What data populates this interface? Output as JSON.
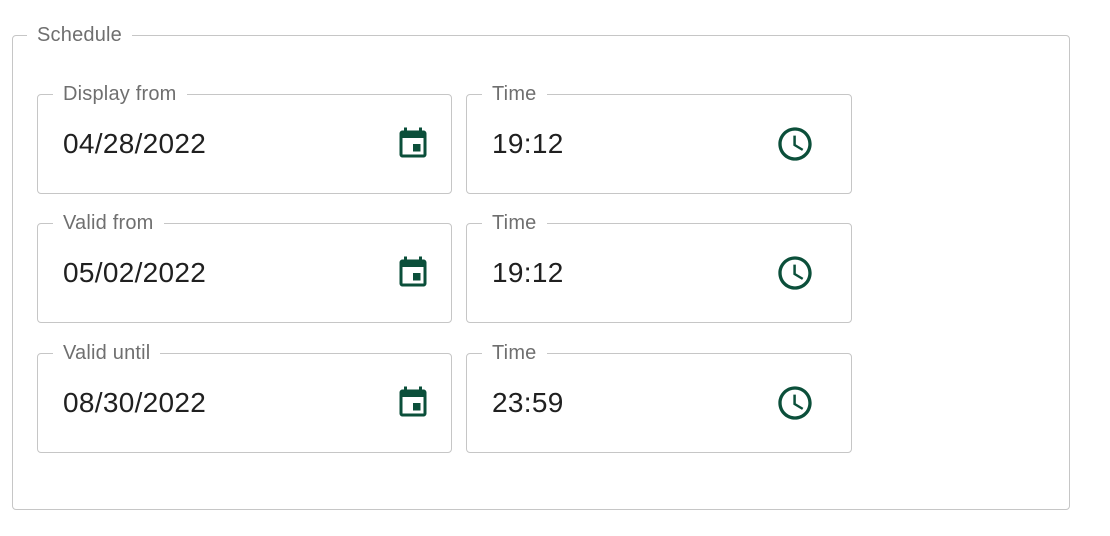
{
  "schedule": {
    "legend": "Schedule",
    "accent_color": "#0b4f3a",
    "rows": [
      {
        "date": {
          "label": "Display from",
          "value": "04/28/2022",
          "icon": "calendar-icon"
        },
        "time": {
          "label": "Time",
          "value": "19:12",
          "icon": "clock-icon"
        }
      },
      {
        "date": {
          "label": "Valid from",
          "value": "05/02/2022",
          "icon": "calendar-icon"
        },
        "time": {
          "label": "Time",
          "value": "19:12",
          "icon": "clock-icon"
        }
      },
      {
        "date": {
          "label": "Valid until",
          "value": "08/30/2022",
          "icon": "calendar-icon"
        },
        "time": {
          "label": "Time",
          "value": "23:59",
          "icon": "clock-icon"
        }
      }
    ]
  }
}
